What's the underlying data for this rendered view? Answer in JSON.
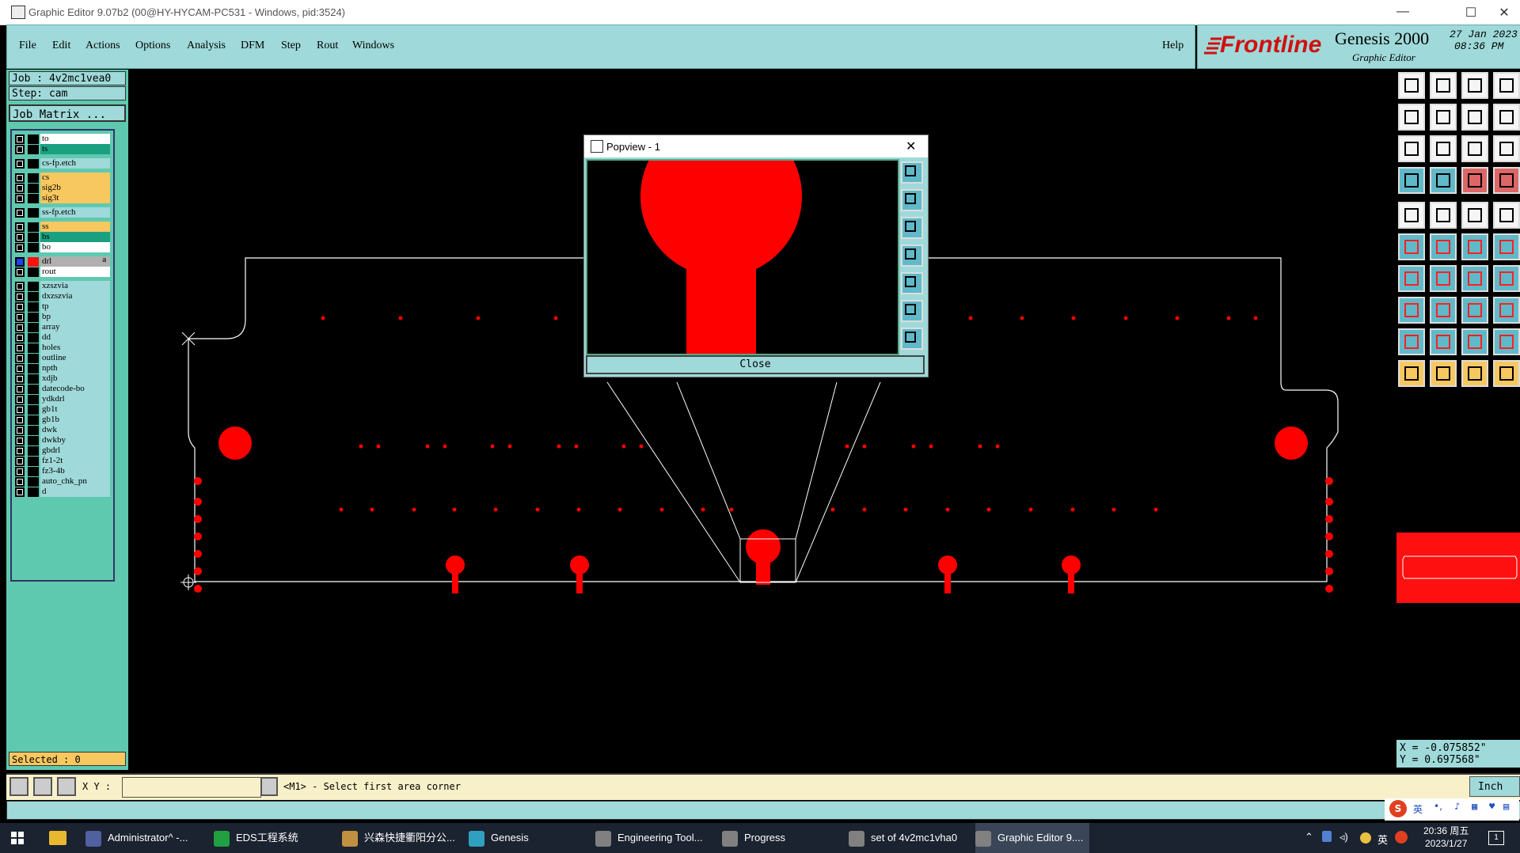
{
  "window": {
    "title": "Graphic Editor 9.07b2 (00@HY-HYCAM-PC531 - Windows, pid:3524)",
    "minimize": "—",
    "maximize": "☐",
    "close": "✕"
  },
  "menu": {
    "items": [
      "File",
      "Edit",
      "Actions",
      "Options",
      "Analysis",
      "DFM",
      "Step",
      "Rout",
      "Windows"
    ],
    "help": "Help"
  },
  "logo": {
    "brand": "Frontline",
    "product": "Genesis 2000",
    "subtitle": "Graphic Editor",
    "date": "27 Jan 2023",
    "time": "08:36 PM"
  },
  "job": {
    "job_label": "Job  :  4v2mc1vea0",
    "step_label": "Step:  cam",
    "matrix_button": "Job Matrix ..."
  },
  "layers": [
    {
      "name": "to",
      "color": "#ffffff"
    },
    {
      "name": "ts",
      "color": "#1aa080"
    },
    {
      "name": "cs-fp.etch",
      "color": "#9fd9d9"
    },
    {
      "name": "cs",
      "color": "#f8c860"
    },
    {
      "name": "sig2b",
      "color": "#f8c860"
    },
    {
      "name": "sig3t",
      "color": "#f8c860"
    },
    {
      "name": "ss-fp.etch",
      "color": "#9fd9d9"
    },
    {
      "name": "ss",
      "color": "#f8c860"
    },
    {
      "name": "bs",
      "color": "#1aa080"
    },
    {
      "name": "bo",
      "color": "#ffffff"
    },
    {
      "name": "drl",
      "color": "#b0b0b0",
      "active": true,
      "flag": "a"
    },
    {
      "name": "rout",
      "color": "#ffffff"
    },
    {
      "name": "xzszvia",
      "color": "#9fd9d9"
    },
    {
      "name": "dxzszvia",
      "color": "#9fd9d9"
    },
    {
      "name": "tp",
      "color": "#9fd9d9"
    },
    {
      "name": "bp",
      "color": "#9fd9d9"
    },
    {
      "name": "array",
      "color": "#9fd9d9"
    },
    {
      "name": "dd",
      "color": "#9fd9d9"
    },
    {
      "name": "holes",
      "color": "#9fd9d9"
    },
    {
      "name": "outline",
      "color": "#9fd9d9"
    },
    {
      "name": "npth",
      "color": "#9fd9d9"
    },
    {
      "name": "xdjb",
      "color": "#9fd9d9"
    },
    {
      "name": "datecode-bo",
      "color": "#9fd9d9"
    },
    {
      "name": "ydkdrl",
      "color": "#9fd9d9"
    },
    {
      "name": "gb1t",
      "color": "#9fd9d9"
    },
    {
      "name": "gb1b",
      "color": "#9fd9d9"
    },
    {
      "name": "dwk",
      "color": "#9fd9d9"
    },
    {
      "name": "dwkby",
      "color": "#9fd9d9"
    },
    {
      "name": "gbdrl",
      "color": "#9fd9d9"
    },
    {
      "name": "fz1-2t",
      "color": "#9fd9d9"
    },
    {
      "name": "fz3-4b",
      "color": "#9fd9d9"
    },
    {
      "name": "auto_chk_pn",
      "color": "#9fd9d9"
    },
    {
      "name": "d",
      "color": "#9fd9d9"
    }
  ],
  "selected": "Selected : 0",
  "popview": {
    "title": "Popview - 1",
    "close_x": "✕",
    "close_button": "Close"
  },
  "coords": {
    "x": "X = -0.075852\"",
    "y": "Y =  0.697568\""
  },
  "command": {
    "xy_label": "X Y :",
    "input_value": "",
    "prompt": "<M1> - Select first area corner",
    "units": "Inch"
  },
  "ime": {
    "lang": "英"
  },
  "taskbar": {
    "tasks": [
      "Administrator^ -...",
      "EDS工程系统",
      "兴森快捷衢阳分公...",
      "Genesis",
      "Engineering Tool...",
      "Progress",
      "set of 4v2mc1vha0",
      "Graphic Editor 9...."
    ],
    "ime_lang": "英",
    "clock_time": "20:36 周五",
    "clock_date": "2023/1/27",
    "notif": "1"
  },
  "colors": {
    "accent_red": "#ff0000",
    "panel_teal": "#5fc9b0",
    "menu_cyan": "#9fd9d9",
    "highlight_yellow": "#f8c860"
  }
}
